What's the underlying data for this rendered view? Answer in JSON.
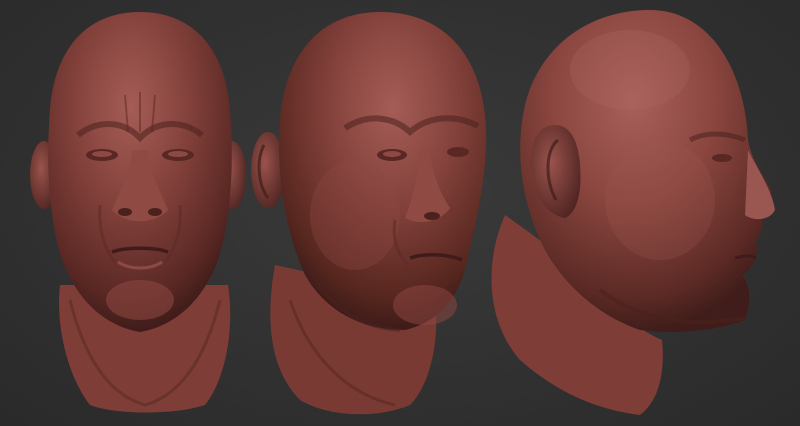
{
  "scene": {
    "background_color": "#313131",
    "material_color": "#7a3b36",
    "highlight_color": "#a9615a",
    "shadow_color": "#3f1c1a",
    "views": [
      {
        "name": "front-view"
      },
      {
        "name": "three-quarter-view"
      },
      {
        "name": "profile-view"
      }
    ]
  }
}
